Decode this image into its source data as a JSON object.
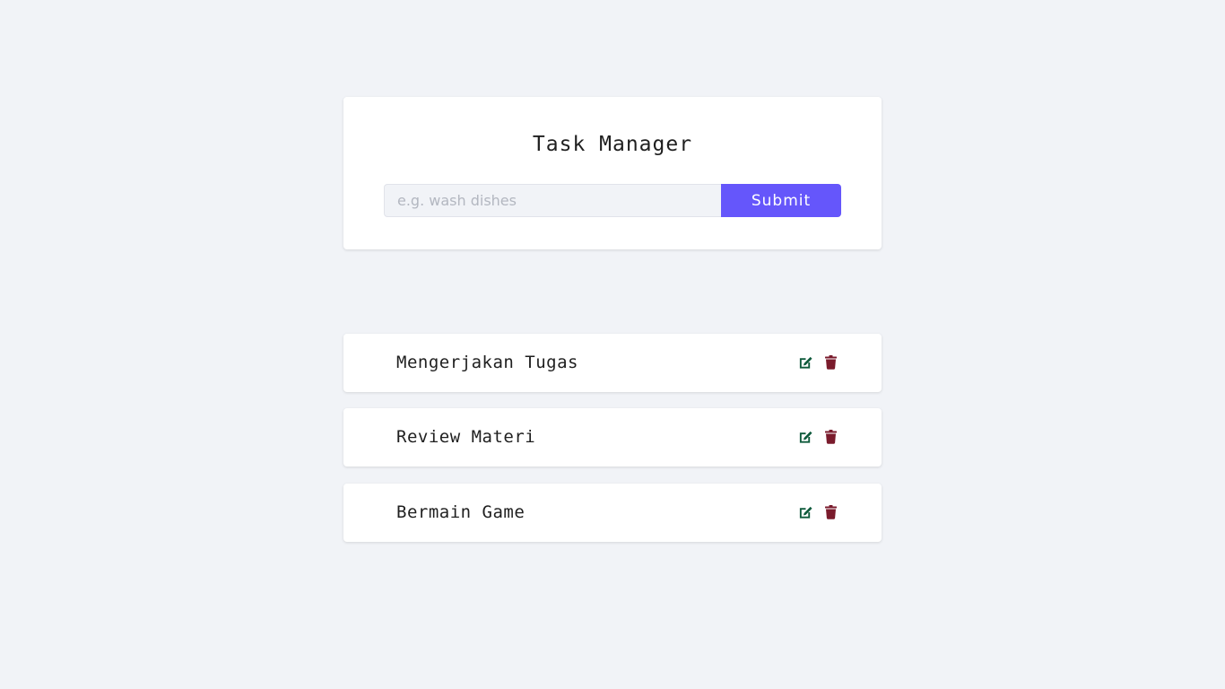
{
  "header": {
    "title": "Task Manager"
  },
  "form": {
    "input_value": "",
    "input_placeholder": "e.g. wash dishes",
    "submit_label": "Submit"
  },
  "tasks": [
    {
      "name": "Mengerjakan Tugas",
      "edit_icon": "edit-icon",
      "delete_icon": "trash-icon"
    },
    {
      "name": "Review Materi",
      "edit_icon": "edit-icon",
      "delete_icon": "trash-icon"
    },
    {
      "name": "Bermain Game",
      "edit_icon": "edit-icon",
      "delete_icon": "trash-icon"
    }
  ],
  "colors": {
    "background": "#f1f3f7",
    "card": "#ffffff",
    "accent": "#6556fb",
    "edit": "#0e5a3b",
    "delete": "#7a1b2c"
  }
}
